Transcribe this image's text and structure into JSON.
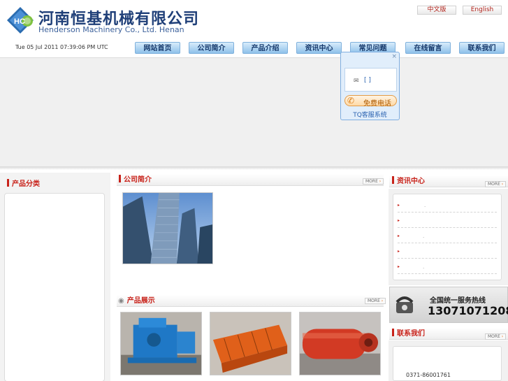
{
  "header": {
    "logo_mark": "HC",
    "company_cn": "河南恒基机械有限公司",
    "company_en": "Henderson Machinery Co., Ltd. Henan",
    "datetime": "Tue 05 Jul 2011 07:39:06 PM UTC"
  },
  "languages": {
    "chinese": "中文版",
    "english": "English"
  },
  "nav": {
    "items": [
      {
        "label": "网站首页"
      },
      {
        "label": "公司简介"
      },
      {
        "label": "产品介绍"
      },
      {
        "label": "资讯中心"
      },
      {
        "label": "常见问题"
      },
      {
        "label": "在线留言"
      },
      {
        "label": "联系我们"
      }
    ]
  },
  "tq_widget": {
    "close": "×",
    "email_label": "[ ]",
    "free_call": "免费电话",
    "system": "TQ客服系统"
  },
  "left": {
    "title": "产品分类"
  },
  "center": {
    "company_title": "公司简介",
    "products_title": "产品展示",
    "more": "MORE"
  },
  "right": {
    "news_title": "资讯中心",
    "news_items": [
      {
        "bullet": "▸",
        "text": "."
      },
      {
        "bullet": "▸",
        "text": ""
      },
      {
        "bullet": "▸",
        "text": "."
      },
      {
        "bullet": "▸",
        "text": ""
      },
      {
        "bullet": "▸",
        "text": "."
      }
    ],
    "hotline_label": "全国统一服务热线",
    "hotline_number": "13071071208",
    "contact_title": "联系我们",
    "contact_phone": "0371-86001761"
  },
  "colors": {
    "accent_red": "#c8221a",
    "nav_blue": "#8fc1ea",
    "brand_blue": "#1f3f78"
  }
}
